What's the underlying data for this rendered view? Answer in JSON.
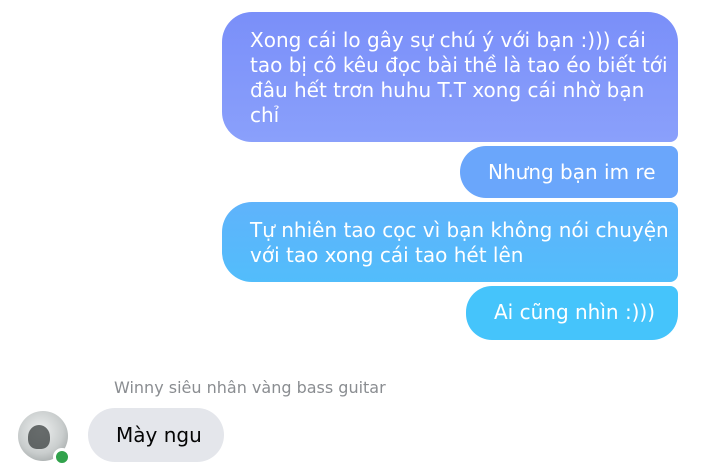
{
  "messages_out": [
    {
      "lines": [
        "Xong cái lo gây sự chú ý với bạn :))) cái",
        "tao bị cô kêu đọc bài thề là tao éo biết tới",
        "đâu hết trơn huhu T.T xong cái nhờ bạn",
        "chỉ"
      ]
    },
    {
      "lines": [
        "Nhưng bạn im re"
      ]
    },
    {
      "lines": [
        "Tự nhiên tao cọc vì bạn không nói chuyện",
        "với tao xong cái tao hét lên"
      ]
    },
    {
      "lines": [
        "Ai cũng nhìn :)))"
      ]
    }
  ],
  "incoming": {
    "sender_name": "Winny siêu nhân vàng bass guitar",
    "text": "Mày ngu",
    "online": true
  },
  "colors": {
    "out_gradient_top": "#7a8ff9",
    "out_gradient_bottom": "#45c4fb",
    "incoming_bubble": "#e4e6eb",
    "online_dot": "#31a24c"
  }
}
